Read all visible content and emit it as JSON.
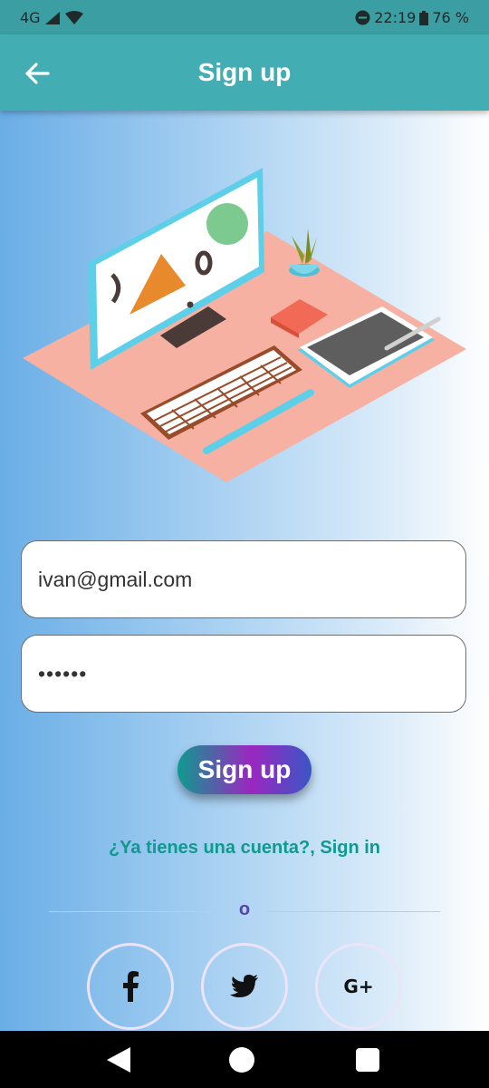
{
  "status_bar": {
    "network": "4G",
    "time": "22:19",
    "battery": "76 %",
    "icons": [
      "signal-icon",
      "wifi-icon",
      "dnd-icon",
      "battery-icon"
    ]
  },
  "appbar": {
    "title": "Sign up",
    "back_icon": "arrow-left-icon"
  },
  "form": {
    "email_value": "ivan@gmail.com",
    "password_value": "••••••",
    "submit_label": "Sign up"
  },
  "signin_link": "¿Ya tienes una cuenta?, Sign in",
  "divider_text": "o",
  "social": {
    "facebook_icon": "facebook-icon",
    "twitter_icon": "twitter-icon",
    "google_label": "G+"
  },
  "nav": [
    "back-icon",
    "home-icon",
    "recents-icon"
  ],
  "colors": {
    "appbar": "#42aeb4",
    "status_bar": "#3a9ea3",
    "accent": "#0e9a8f",
    "divider_text": "#5a3fb0"
  }
}
